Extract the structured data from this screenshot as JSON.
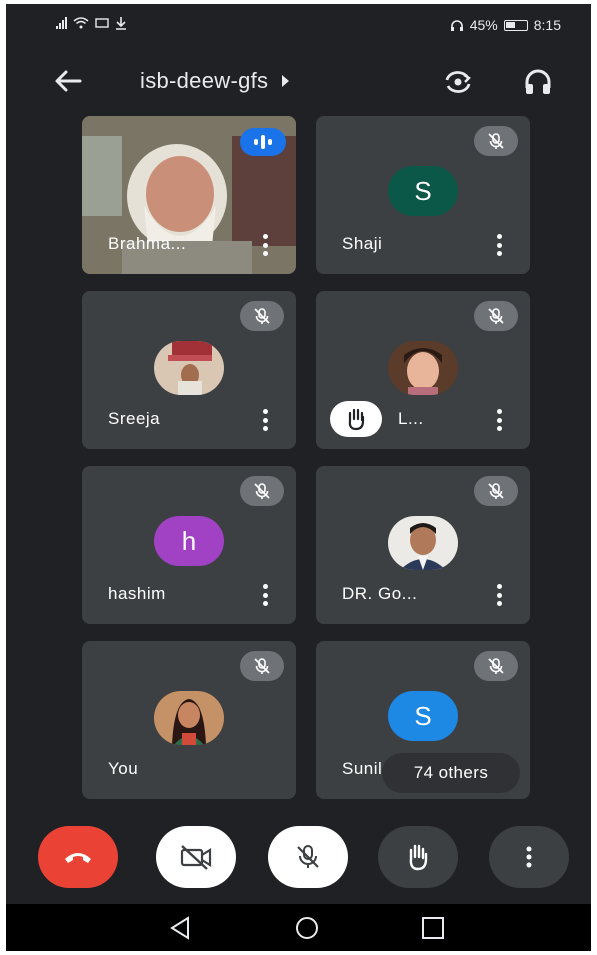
{
  "status_bar": {
    "battery_percent": "45%",
    "time": "8:15"
  },
  "meeting": {
    "title": "isb-deew-gfs"
  },
  "participants": [
    {
      "name": "Brahma...",
      "avatar": "photo",
      "speaking": true
    },
    {
      "name": "Shaji",
      "avatar": "letter",
      "initial": "S",
      "color": "#0b5848",
      "muted": true
    },
    {
      "name": "Sreeja",
      "avatar": "photo",
      "muted": true
    },
    {
      "name": "L...",
      "avatar": "photo",
      "muted": true,
      "hand_raised": true
    },
    {
      "name": "hashim",
      "avatar": "letter",
      "initial": "h",
      "color": "#a142c4",
      "muted": true
    },
    {
      "name": "DR. Go...",
      "avatar": "photo",
      "muted": true
    },
    {
      "name": "You",
      "avatar": "photo",
      "muted": true
    },
    {
      "name": "Sunil",
      "avatar": "letter",
      "initial": "S",
      "color": "#1e88e5",
      "muted": true
    }
  ],
  "others_chip": "74 others",
  "colors": {
    "background": "#202124",
    "tile": "#3c4043",
    "end_call": "#ea4335",
    "speaking": "#1a73e8"
  }
}
